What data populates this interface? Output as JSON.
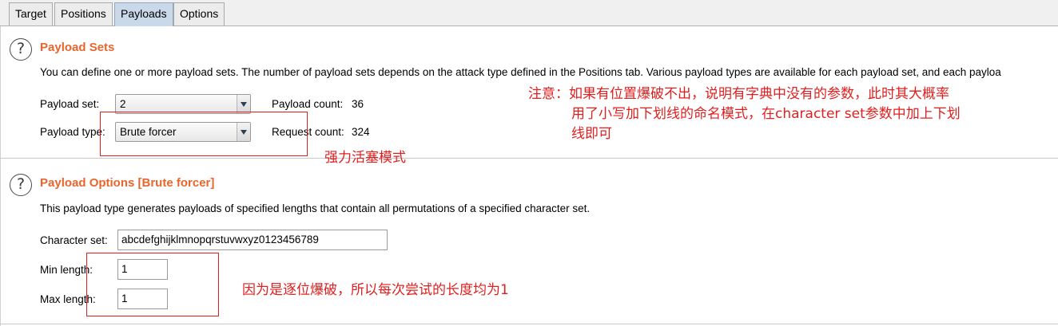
{
  "tabs": [
    "Target",
    "Positions",
    "Payloads",
    "Options"
  ],
  "active_tab": "Payloads",
  "payload_sets": {
    "title": "Payload Sets",
    "description": "You can define one or more payload sets. The number of payload sets depends on the attack type defined in the Positions tab. Various payload types are available for each payload set, and each payloa",
    "payload_set_label": "Payload set:",
    "payload_set_value": "2",
    "payload_count_label": "Payload count:",
    "payload_count_value": "36",
    "payload_type_label": "Payload type:",
    "payload_type_value": "Brute forcer",
    "request_count_label": "Request count:",
    "request_count_value": "324"
  },
  "payload_options": {
    "title": "Payload Options [Brute forcer]",
    "description": "This payload type generates payloads of specified lengths that contain all permutations of a specified character set.",
    "character_set_label": "Character set:",
    "character_set_value": "abcdefghijklmnopqrstuvwxyz0123456789",
    "min_length_label": "Min length:",
    "min_length_value": "1",
    "max_length_label": "Max length:",
    "max_length_value": "1"
  },
  "annotations": {
    "note_line1": "注意：如果有位置爆破不出，说明有字典中没有的参数，此时其大概率",
    "note_line2": "用了小写加下划线的命名模式，在character set参数中加上下划",
    "note_line3": "线即可",
    "brute_mode": "强力活塞模式",
    "length_note": "因为是逐位爆破，所以每次尝试的长度均为1"
  },
  "colors": {
    "section_title": "#e8662c",
    "annotation_red": "#e02020",
    "active_tab": "#c9d9ea"
  },
  "icons": {
    "help": "question-mark-circle-icon",
    "dropdown": "triangle-down-icon"
  }
}
